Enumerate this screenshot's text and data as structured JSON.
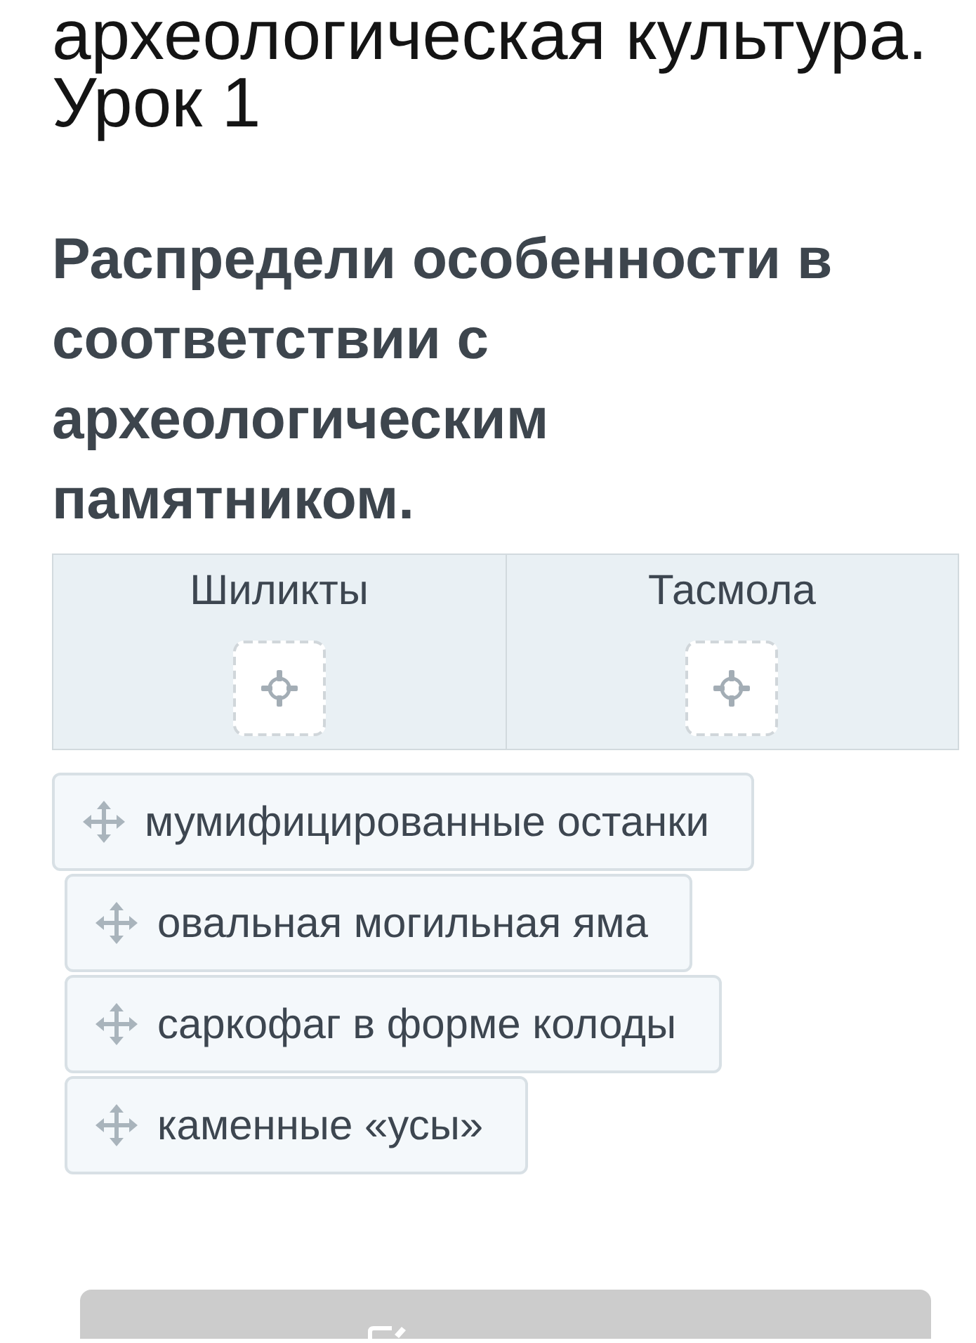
{
  "title": "археологическая культура. Урок 1",
  "instruction": "Распредели особенности в соответствии с археологическим памятником.",
  "columns": [
    {
      "heading": "Шиликты"
    },
    {
      "heading": "Тасмола"
    }
  ],
  "items": [
    {
      "label": "мумифицированные останки"
    },
    {
      "label": "овальная могильная яма"
    },
    {
      "label": "саркофаг в форме колоды"
    },
    {
      "label": "каменные «усы»"
    }
  ],
  "check_button": {
    "disabled": true
  }
}
